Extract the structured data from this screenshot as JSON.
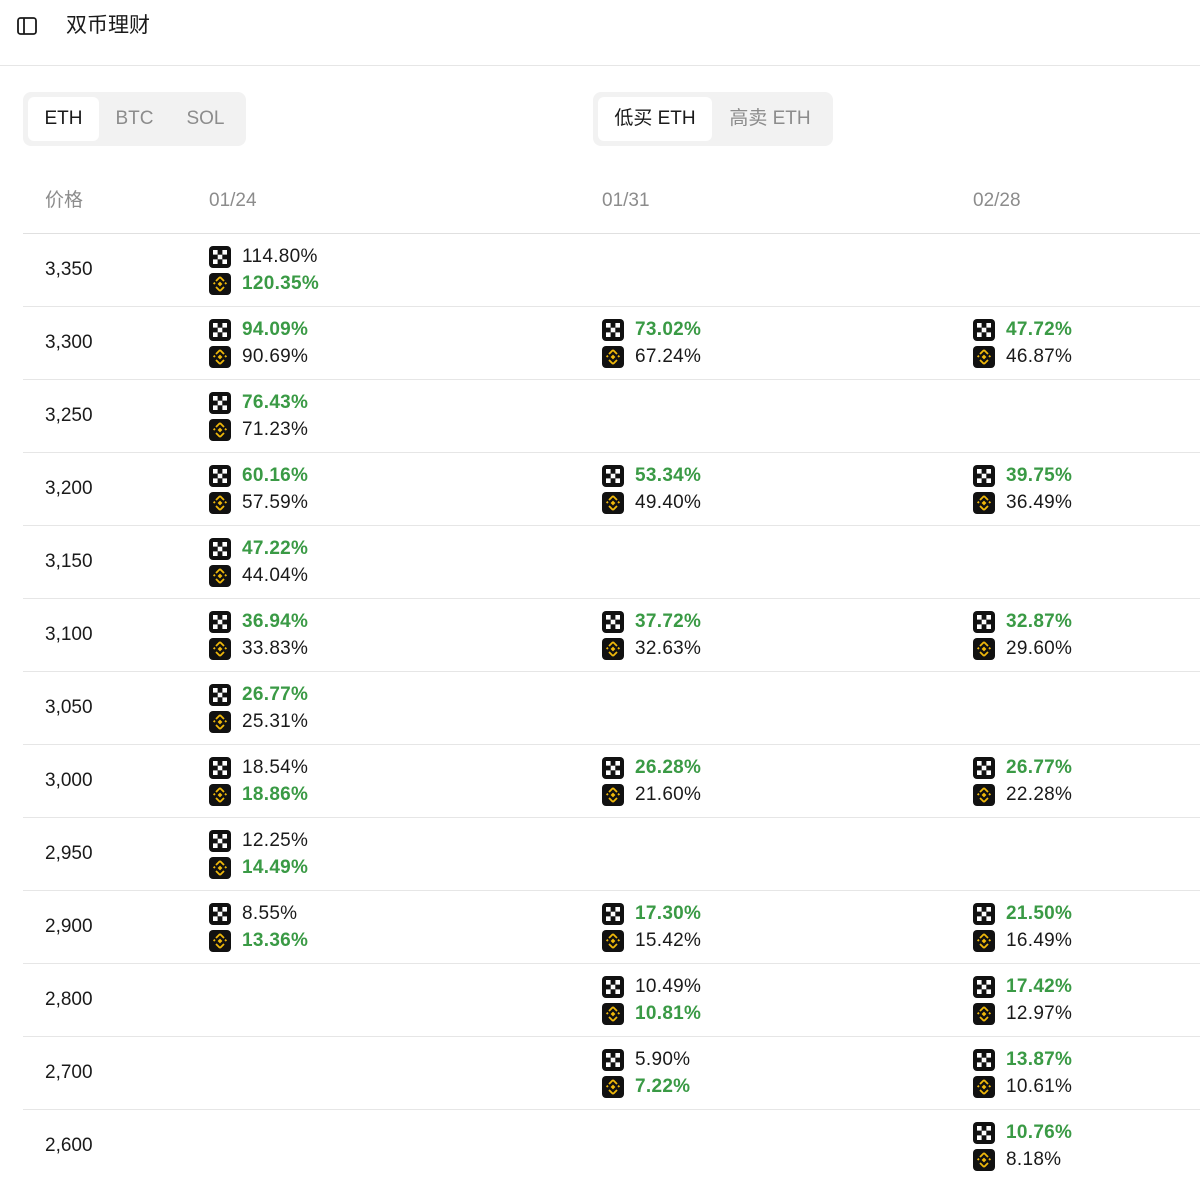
{
  "header": {
    "title": "双币理财"
  },
  "asset_tabs": [
    {
      "label": "ETH",
      "active": true
    },
    {
      "label": "BTC",
      "active": false
    },
    {
      "label": "SOL",
      "active": false
    }
  ],
  "direction_tabs": [
    {
      "label": "低买 ETH",
      "active": true
    },
    {
      "label": "高卖 ETH",
      "active": false
    }
  ],
  "table": {
    "columns": [
      "价格",
      "01/24",
      "01/31",
      "02/28"
    ],
    "rows": [
      {
        "price": "3,350",
        "cells": [
          {
            "okx": "114.80%",
            "binance": "120.35%",
            "best": "binance"
          },
          null,
          null
        ]
      },
      {
        "price": "3,300",
        "cells": [
          {
            "okx": "94.09%",
            "binance": "90.69%",
            "best": "okx"
          },
          {
            "okx": "73.02%",
            "binance": "67.24%",
            "best": "okx"
          },
          {
            "okx": "47.72%",
            "binance": "46.87%",
            "best": "okx"
          }
        ]
      },
      {
        "price": "3,250",
        "cells": [
          {
            "okx": "76.43%",
            "binance": "71.23%",
            "best": "okx"
          },
          null,
          null
        ]
      },
      {
        "price": "3,200",
        "cells": [
          {
            "okx": "60.16%",
            "binance": "57.59%",
            "best": "okx"
          },
          {
            "okx": "53.34%",
            "binance": "49.40%",
            "best": "okx"
          },
          {
            "okx": "39.75%",
            "binance": "36.49%",
            "best": "okx"
          }
        ]
      },
      {
        "price": "3,150",
        "cells": [
          {
            "okx": "47.22%",
            "binance": "44.04%",
            "best": "okx"
          },
          null,
          null
        ]
      },
      {
        "price": "3,100",
        "cells": [
          {
            "okx": "36.94%",
            "binance": "33.83%",
            "best": "okx"
          },
          {
            "okx": "37.72%",
            "binance": "32.63%",
            "best": "okx"
          },
          {
            "okx": "32.87%",
            "binance": "29.60%",
            "best": "okx"
          }
        ]
      },
      {
        "price": "3,050",
        "cells": [
          {
            "okx": "26.77%",
            "binance": "25.31%",
            "best": "okx"
          },
          null,
          null
        ]
      },
      {
        "price": "3,000",
        "cells": [
          {
            "okx": "18.54%",
            "binance": "18.86%",
            "best": "binance"
          },
          {
            "okx": "26.28%",
            "binance": "21.60%",
            "best": "okx"
          },
          {
            "okx": "26.77%",
            "binance": "22.28%",
            "best": "okx"
          }
        ]
      },
      {
        "price": "2,950",
        "cells": [
          {
            "okx": "12.25%",
            "binance": "14.49%",
            "best": "binance"
          },
          null,
          null
        ]
      },
      {
        "price": "2,900",
        "cells": [
          {
            "okx": "8.55%",
            "binance": "13.36%",
            "best": "binance"
          },
          {
            "okx": "17.30%",
            "binance": "15.42%",
            "best": "okx"
          },
          {
            "okx": "21.50%",
            "binance": "16.49%",
            "best": "okx"
          }
        ]
      },
      {
        "price": "2,800",
        "cells": [
          null,
          {
            "okx": "10.49%",
            "binance": "10.81%",
            "best": "binance"
          },
          {
            "okx": "17.42%",
            "binance": "12.97%",
            "best": "okx"
          }
        ]
      },
      {
        "price": "2,700",
        "cells": [
          null,
          {
            "okx": "5.90%",
            "binance": "7.22%",
            "best": "binance"
          },
          {
            "okx": "13.87%",
            "binance": "10.61%",
            "best": "okx"
          }
        ]
      },
      {
        "price": "2,600",
        "cells": [
          null,
          null,
          {
            "okx": "10.76%",
            "binance": "8.18%",
            "best": "okx"
          }
        ]
      }
    ]
  },
  "icons": {
    "okx": "okx-logo-icon",
    "binance": "binance-logo-icon",
    "sidebar": "sidebar-toggle-icon"
  },
  "colors": {
    "best": "#3a9a45",
    "binance_gold": "#f0b90b",
    "logo_bg": "#111111"
  }
}
